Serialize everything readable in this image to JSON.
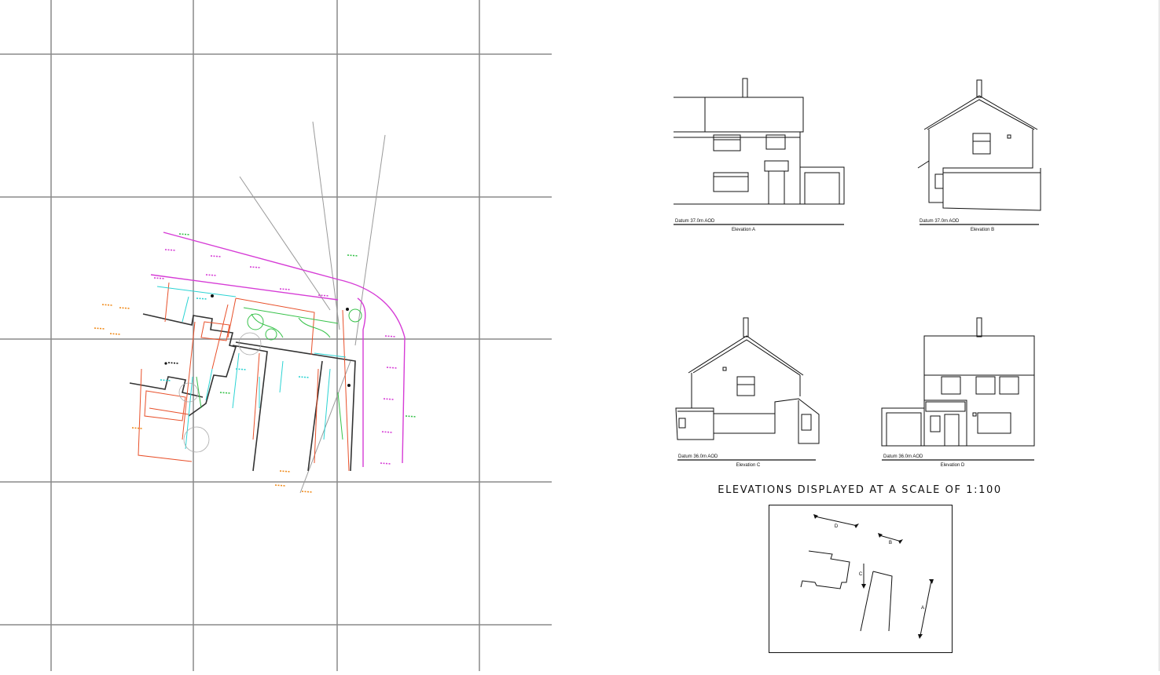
{
  "elevations": [
    {
      "datum": "Datum 37.0m AOD",
      "title": "Elevation A"
    },
    {
      "datum": "Datum 37.0m AOD",
      "title": "Elevation B"
    },
    {
      "datum": "Datum 36.0m AOD",
      "title": "Elevation C"
    },
    {
      "datum": "Datum 36.0m AOD",
      "title": "Elevation D"
    }
  ],
  "scale_note": "ELEVATIONS DISPLAYED AT A SCALE OF 1:100",
  "key_plan": {
    "markers": [
      "D",
      "B",
      "C",
      "A"
    ]
  },
  "colors": {
    "grid": "#8a8a8a",
    "boundary": "#d63cd6",
    "building": "#e8502a",
    "services": "#2bd3d3",
    "vegetation": "#37c24a",
    "levels": "#f08a1a",
    "walls": "#333333"
  }
}
